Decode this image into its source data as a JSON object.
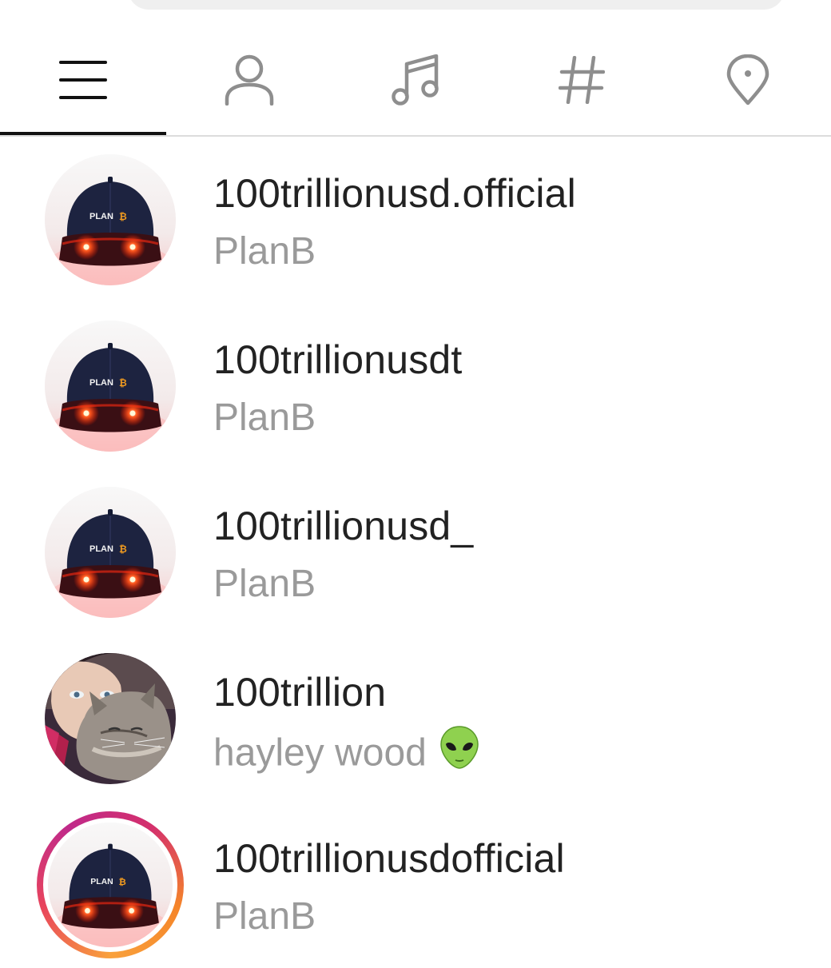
{
  "search": {
    "placeholder": ""
  },
  "tabs": [
    {
      "name": "Top",
      "icon": "menu-icon",
      "active": true
    },
    {
      "name": "Accounts",
      "icon": "person-icon",
      "active": false
    },
    {
      "name": "Audio",
      "icon": "music-note-icon",
      "active": false
    },
    {
      "name": "Tags",
      "icon": "hashtag-icon",
      "active": false
    },
    {
      "name": "Places",
      "icon": "location-pin-icon",
      "active": false
    }
  ],
  "results": [
    {
      "username": "100trillionusd.official",
      "full_name": "PlanB",
      "avatar": "planb-cap-avatar",
      "story_ring": false
    },
    {
      "username": "100trillionusdt",
      "full_name": "PlanB",
      "avatar": "planb-cap-avatar",
      "story_ring": false
    },
    {
      "username": "100trillionusd_",
      "full_name": "PlanB",
      "avatar": "planb-cap-avatar",
      "story_ring": false
    },
    {
      "username": "100trillion",
      "full_name": "hayley wood",
      "emoji": "alien-emoji",
      "avatar": "person-with-cat-avatar",
      "story_ring": false
    },
    {
      "username": "100trillionusdofficial",
      "full_name": "PlanB",
      "avatar": "planb-cap-avatar",
      "story_ring": true
    }
  ],
  "colors": {
    "active_icon": "#111111",
    "inactive_icon": "#8e8e8e",
    "secondary_text": "#9a9a9a",
    "primary_text": "#222222"
  }
}
